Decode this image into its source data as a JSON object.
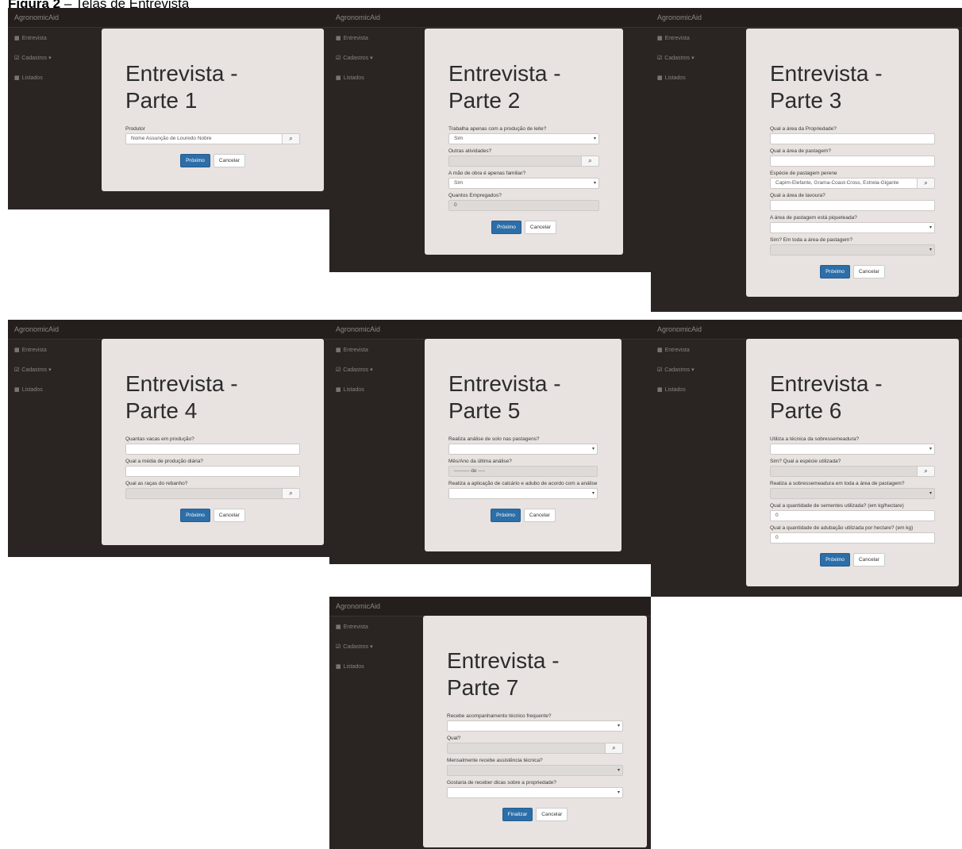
{
  "figure": {
    "label": "Figura 2",
    "caption": " – Telas de Entrevista"
  },
  "app": {
    "brand": "AgronomicAid",
    "nav": [
      {
        "icon": "▦",
        "label": "Entrevista"
      },
      {
        "icon": "☑",
        "label": "Cadastros ▾"
      },
      {
        "icon": "▦",
        "label": "Listados"
      }
    ]
  },
  "buttons": {
    "next": "Próximo",
    "cancel": "Cancelar",
    "finish": "Finalizar"
  },
  "screens": [
    {
      "title": "Entrevista -\nParte 1",
      "fields": [
        {
          "label": "Produtor",
          "value": "Nome Assunção de Louredo Nobre",
          "type": "search"
        }
      ]
    },
    {
      "title": "Entrevista -\nParte 2",
      "fields": [
        {
          "label": "Trabalha apenas com a produção de leite?",
          "value": "Sim",
          "type": "select"
        },
        {
          "label": "Outras atividades?",
          "value": "",
          "type": "search",
          "disabled": true
        },
        {
          "label": "A mão de obra é apenas familiar?",
          "value": "Sim",
          "type": "select"
        },
        {
          "label": "Quantos Empregados?",
          "value": "0",
          "type": "text",
          "disabled": true
        }
      ]
    },
    {
      "title": "Entrevista -\nParte 3",
      "fields": [
        {
          "label": "Qual a área da Propriedade?",
          "value": "",
          "type": "text"
        },
        {
          "label": "Qual a área de pastagem?",
          "value": "",
          "type": "text"
        },
        {
          "label": "Espécie de pastagem perene",
          "value": "Capim-Elefante, Grama-Coast-Cross, Estrela-Gigante",
          "type": "search"
        },
        {
          "label": "Qual a área de lavoura?",
          "value": "",
          "type": "text"
        },
        {
          "label": "A área de pastagem está piqueteada?",
          "value": "",
          "type": "select"
        },
        {
          "label": "Sim? Em toda a área de pastagem?",
          "value": "",
          "type": "select",
          "disabled": true
        }
      ]
    },
    {
      "title": "Entrevista -\nParte 4",
      "fields": [
        {
          "label": "Quantas vacas em produção?",
          "value": "",
          "type": "text"
        },
        {
          "label": "Qual a média de produção diária?",
          "value": "",
          "type": "text"
        },
        {
          "label": "Qual as raças do rebanho?",
          "value": "",
          "type": "search",
          "disabled": true
        }
      ]
    },
    {
      "title": "Entrevista -\nParte 5",
      "fields": [
        {
          "label": "Realiza análise de solo nas pastagens?",
          "value": "",
          "type": "select"
        },
        {
          "label": "Mês/Ano da última análise?",
          "value": "--------- de ----",
          "type": "text",
          "disabled": true
        },
        {
          "label": "Realiza a aplicação de calcário e adubo de acordo com a análise e as correções necessárias?",
          "value": "",
          "type": "select"
        }
      ]
    },
    {
      "title": "Entrevista -\nParte 6",
      "fields": [
        {
          "label": "Utiliza a técnica da sobressemeadura?",
          "value": "",
          "type": "select"
        },
        {
          "label": "Sim? Qual a espécie utilizada?",
          "value": "",
          "type": "search",
          "disabled": true
        },
        {
          "label": "Realiza a sobressemeadura em toda a área de pastagem?",
          "value": "",
          "type": "select",
          "disabled": true
        },
        {
          "label": "Qual a quantidade de sementes utilizada? (em kg/hectare)",
          "value": "0",
          "type": "text"
        },
        {
          "label": "Qual a quantidade de adubação utilizada por hectare? (em kg)",
          "value": "0",
          "type": "text"
        }
      ]
    },
    {
      "title": "Entrevista -\nParte 7",
      "fields": [
        {
          "label": "Recebe acompanhamento técnico frequente?",
          "value": "",
          "type": "select"
        },
        {
          "label": "Qual?",
          "value": "",
          "type": "search",
          "disabled": true
        },
        {
          "label": "Mensalmente recebe assistência técnica?",
          "value": "",
          "type": "select",
          "disabled": true
        },
        {
          "label": "Gostaria de receber dicas sobre a propriedade?",
          "value": "",
          "type": "select"
        }
      ],
      "final": true
    }
  ]
}
